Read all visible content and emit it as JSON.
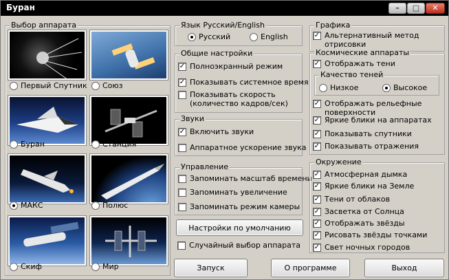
{
  "window": {
    "title": "Буран",
    "min": "–",
    "max": "□",
    "close": "✕"
  },
  "craft_group": {
    "title": "Выбор аппарата",
    "items": [
      {
        "label": "Первый Спутник",
        "selected": false
      },
      {
        "label": "Союз",
        "selected": false
      },
      {
        "label": "Буран",
        "selected": false
      },
      {
        "label": "Станция",
        "selected": false
      },
      {
        "label": "МАКС",
        "selected": true
      },
      {
        "label": "Полюс",
        "selected": false
      },
      {
        "label": "Скиф",
        "selected": false
      },
      {
        "label": "Мир",
        "selected": false
      }
    ]
  },
  "language": {
    "title": "Язык  Русский/English",
    "russian": "Русский",
    "english": "English",
    "selected": "Русский"
  },
  "general": {
    "title": "Общие настройки",
    "fullscreen": "Полноэкранный режим",
    "show_time": "Показывать системное время",
    "show_fps_1": "Показывать скорость",
    "show_fps_2": "(количество кадров/сек)"
  },
  "sound": {
    "title": "Звуки",
    "enable": "Включить звуки",
    "hw_accel": "Аппаратное ускорение звука"
  },
  "control": {
    "title": "Управление",
    "time_scale": "Запоминать масштаб времени",
    "zoom": "Запоминать увеличение",
    "camera": "Запоминать режим камеры"
  },
  "defaults_button": "Настройки по умолчанию",
  "random_craft": "Случайный выбор аппарата",
  "graphics": {
    "title": "Графика",
    "alt_render_1": "Альтернативный метод",
    "alt_render_2": "отрисовки"
  },
  "spacecraft": {
    "title": "Космические аппараты",
    "shadows": "Отображать тени",
    "shadow_quality": {
      "title": "Качество теней",
      "low": "Низкое",
      "high": "Высокое",
      "selected": "Высокое"
    },
    "relief_1": "Отображать рельефные",
    "relief_2": "поверхности",
    "highlights": "Яркие блики на аппаратах",
    "satellites": "Показывать спутники",
    "reflections": "Показывать отражения"
  },
  "environment": {
    "title": "Окружение",
    "haze": "Атмосферная дымка",
    "earth_highlights": "Яркие блики на Земле",
    "cloud_shadows": "Тени от облаков",
    "sun_flare": "Засветка от Солнца",
    "stars": "Отображать звёзды",
    "star_points": "Рисовать звёзды точками",
    "city_lights": "Свет ночных городов"
  },
  "buttons": {
    "launch": "Запуск",
    "about": "О программе",
    "exit": "Выход"
  },
  "check_mark": "✓"
}
